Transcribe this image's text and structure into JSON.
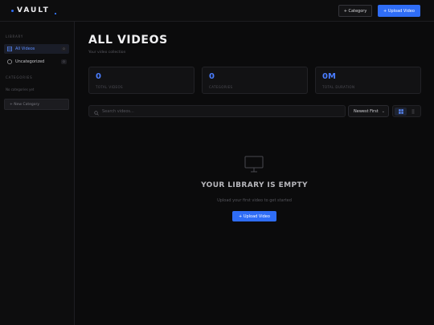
{
  "app": {
    "logo_text": "VAULT"
  },
  "header": {
    "category_button": "+ Category",
    "upload_button": "+ Upload Video"
  },
  "sidebar": {
    "library_heading": "LIBRARY",
    "items": [
      {
        "label": "All Videos",
        "count": "0",
        "icon": "grid-icon",
        "active": true
      },
      {
        "label": "Uncategorized",
        "count": "0",
        "icon": "clock-icon",
        "active": false
      }
    ],
    "categories_heading": "CATEGORIES",
    "categories_empty": "No categories yet",
    "new_category_button": "+ New Category"
  },
  "main": {
    "title": "ALL VIDEOS",
    "subtitle": "Your video collection",
    "stats": [
      {
        "value": "0",
        "label": "TOTAL VIDEOS"
      },
      {
        "value": "0",
        "label": "CATEGORIES"
      },
      {
        "value": "0M",
        "label": "TOTAL DURATION"
      }
    ],
    "search": {
      "placeholder": "Search videos...",
      "value": ""
    },
    "sort": {
      "selected": "Newest First"
    },
    "view": {
      "active": "grid"
    }
  },
  "empty_state": {
    "icon": "monitor-icon",
    "title": "YOUR LIBRARY IS EMPTY",
    "message": "Upload your first video to get started",
    "button": "+ Upload Video"
  },
  "colors": {
    "accent": "#2f6df6",
    "accent_text": "#4a7dff",
    "background": "#0b0b0c",
    "surface": "#121214"
  }
}
